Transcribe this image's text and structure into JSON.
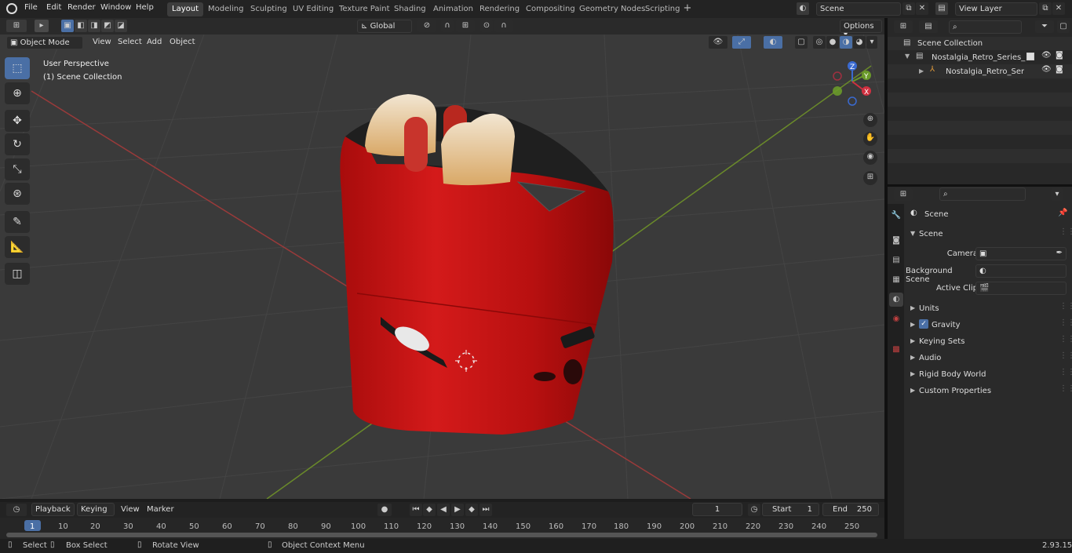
{
  "menus": [
    "File",
    "Edit",
    "Render",
    "Window",
    "Help"
  ],
  "workspaces": [
    "Layout",
    "Modeling",
    "Sculpting",
    "UV Editing",
    "Texture Paint",
    "Shading",
    "Animation",
    "Rendering",
    "Compositing",
    "Geometry Nodes",
    "Scripting"
  ],
  "active_workspace": "Layout",
  "scene_field": "Scene",
  "viewlayer_field": "View Layer",
  "viewport_header": {
    "mode": "Object Mode",
    "menus": [
      "View",
      "Select",
      "Add",
      "Object"
    ],
    "transform": "Global",
    "options": "Options"
  },
  "viewport_overlay": {
    "perspective": "User Perspective",
    "collection": "(1) Scene Collection"
  },
  "gizmo": {
    "z": "Z",
    "y": "Y",
    "x": "X"
  },
  "outliner": {
    "root": "Scene Collection",
    "items": [
      "Nostalgia_Retro_Series_Pop_U",
      "Nostalgia_Retro_Series_F"
    ]
  },
  "properties": {
    "header": "Scene",
    "section": "Scene",
    "fields": [
      {
        "label": "Camera"
      },
      {
        "label": "Background Scene"
      },
      {
        "label": "Active Clip"
      }
    ],
    "panels": [
      "Units",
      "Gravity",
      "Keying Sets",
      "Audio",
      "Rigid Body World",
      "Custom Properties"
    ]
  },
  "timeline": {
    "menus": [
      "Playback",
      "Keying",
      "View",
      "Marker"
    ],
    "current_frame": "1",
    "start_label": "Start",
    "start": "1",
    "end_label": "End",
    "end": "250",
    "ticks": [
      "1",
      "10",
      "20",
      "30",
      "40",
      "50",
      "60",
      "70",
      "80",
      "90",
      "100",
      "110",
      "120",
      "130",
      "140",
      "150",
      "160",
      "170",
      "180",
      "190",
      "200",
      "210",
      "220",
      "230",
      "240",
      "250"
    ]
  },
  "status": {
    "select": "Select",
    "box_select": "Box Select",
    "rotate": "Rotate View",
    "context": "Object Context Menu",
    "version": "2.93.15"
  },
  "colors": {
    "accent": "#4a6fa5",
    "toaster": "#c81414",
    "x_axis": "#9a3a3a",
    "y_axis": "#6a8a2a"
  }
}
